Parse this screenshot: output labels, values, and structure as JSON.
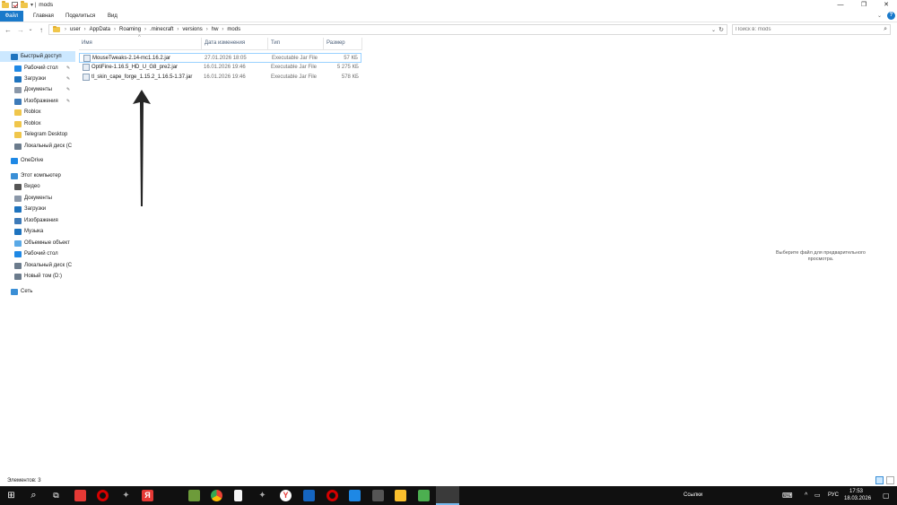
{
  "window": {
    "title": "mods",
    "controls": {
      "minimize": "—",
      "maximize": "❐",
      "close": "✕"
    }
  },
  "ribbon": {
    "tabs": [
      {
        "label": "Файл"
      },
      {
        "label": "Главная"
      },
      {
        "label": "Поделиться"
      },
      {
        "label": "Вид"
      }
    ],
    "help": "?"
  },
  "nav": {
    "back": "←",
    "forward": "→",
    "recent": "⌄",
    "up": "↑",
    "refresh": "↻"
  },
  "address": {
    "crumbs": [
      "user",
      "AppData",
      "Roaming",
      ".minecraft",
      "versions",
      "hw",
      "mods"
    ]
  },
  "search": {
    "placeholder": "Поиск в: mods"
  },
  "sidebar": {
    "items": [
      {
        "label": "Быстрый доступ",
        "icon": "star-icon",
        "pinned": false,
        "color": "#1e73be"
      },
      {
        "label": "Рабочий стол",
        "icon": "desktop-icon",
        "pinned": true,
        "color": "#1e88e5"
      },
      {
        "label": "Загрузки",
        "icon": "download-icon",
        "pinned": true,
        "color": "#1e73be"
      },
      {
        "label": "Документы",
        "icon": "documents-icon",
        "pinned": true,
        "color": "#8a97a8"
      },
      {
        "label": "Изображения",
        "icon": "pictures-icon",
        "pinned": true,
        "color": "#3d7ab8"
      },
      {
        "label": "Roblox",
        "icon": "folder-icon",
        "pinned": false,
        "color": "#f0c64b"
      },
      {
        "label": "Roblox",
        "icon": "folder-icon",
        "pinned": false,
        "color": "#f0c64b"
      },
      {
        "label": "Telegram Desktop",
        "icon": "folder-icon",
        "pinned": false,
        "color": "#f0c64b"
      },
      {
        "label": "Локальный диск (C",
        "icon": "drive-icon",
        "pinned": false,
        "color": "#6b7b8c"
      },
      {
        "label": "OneDrive",
        "icon": "cloud-icon",
        "pinned": false,
        "color": "#1e88e5"
      },
      {
        "label": "Этот компьютер",
        "icon": "computer-icon",
        "pinned": false,
        "color": "#3a8fd6"
      },
      {
        "label": "Видео",
        "icon": "video-icon",
        "pinned": false,
        "color": "#555"
      },
      {
        "label": "Документы",
        "icon": "documents-icon",
        "pinned": false,
        "color": "#8a97a8"
      },
      {
        "label": "Загрузки",
        "icon": "download-icon",
        "pinned": false,
        "color": "#1e73be"
      },
      {
        "label": "Изображения",
        "icon": "pictures-icon",
        "pinned": false,
        "color": "#3d7ab8"
      },
      {
        "label": "Музыка",
        "icon": "music-icon",
        "pinned": false,
        "color": "#1e73be"
      },
      {
        "label": "Объемные объект",
        "icon": "objects3d-icon",
        "pinned": false,
        "color": "#5aa9e6"
      },
      {
        "label": "Рабочий стол",
        "icon": "desktop-icon",
        "pinned": false,
        "color": "#1e88e5"
      },
      {
        "label": "Локальный диск (C",
        "icon": "drive-icon",
        "pinned": false,
        "color": "#6b7b8c"
      },
      {
        "label": "Новый том (D:)",
        "icon": "drive-icon",
        "pinned": false,
        "color": "#6b7b8c"
      },
      {
        "label": "Сеть",
        "icon": "network-icon",
        "pinned": false,
        "color": "#3a8fd6"
      }
    ]
  },
  "list": {
    "columns": [
      "Имя",
      "Дата изменения",
      "Тип",
      "Размер"
    ],
    "rows": [
      {
        "name": "MouseTweaks-2.14-mc1.16.2.jar",
        "date": "27.01.2026 18:05",
        "type": "Executable Jar File",
        "size": "57 КБ"
      },
      {
        "name": "OptiFine-1.16.5_HD_U_G8_pre2.jar",
        "date": "16.01.2026 19:46",
        "type": "Executable Jar File",
        "size": "5 275 КБ"
      },
      {
        "name": "tl_skin_cape_forge_1.15.2_1.16.5-1.37.jar",
        "date": "16.01.2026 19:46",
        "type": "Executable Jar File",
        "size": "578 КБ"
      }
    ]
  },
  "preview": {
    "text": "Выберите файл для предварительного просмотра."
  },
  "status": {
    "items": "Элементов: 3"
  },
  "taskbar": {
    "links_label": "Ссылки",
    "lang": "РУС",
    "time": "17:53",
    "date": "18.03.2026",
    "accent": "#101010"
  }
}
